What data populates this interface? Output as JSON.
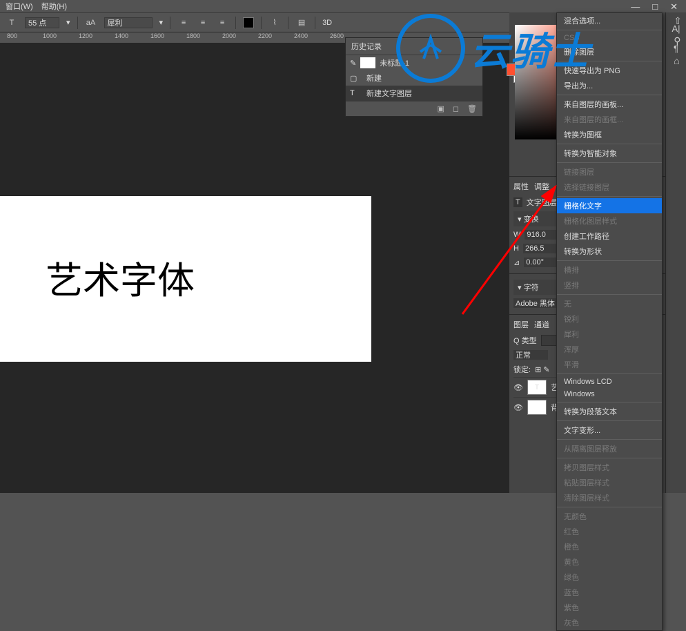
{
  "menubar": {
    "window": "窗口(W)",
    "help": "帮助(H)"
  },
  "options_bar": {
    "font_size_label": "T",
    "font_size": "55 点",
    "aa_label": "aA",
    "aa_mode": "犀利",
    "threeD": "3D"
  },
  "ruler": [
    "800",
    "1000",
    "1200",
    "1400",
    "1600",
    "1800",
    "2000",
    "2200",
    "2400",
    "2600"
  ],
  "canvas": {
    "text": "艺术字体"
  },
  "history": {
    "title": "历史记录",
    "doc_name": "未标题-1",
    "items": [
      {
        "icon": "new",
        "label": "新建"
      },
      {
        "icon": "T",
        "label": "新建文字图层"
      }
    ]
  },
  "properties": {
    "tab_props": "属性",
    "tab_adjust": "调整",
    "type_label": "文字图层",
    "transform_hdr": "变换",
    "w_label": "W",
    "w_val": "916.0",
    "h_label": "H",
    "h_val": "266.5",
    "angle_val": "0.00°"
  },
  "character": {
    "hdr": "字符",
    "font": "Adobe 黑体 Std"
  },
  "layers": {
    "tab_layers": "图层",
    "tab_channels": "通道",
    "filter_label": "Q 类型",
    "blend": "正常",
    "lock_label": "锁定:",
    "items": [
      {
        "type": "T",
        "name": "艺术"
      },
      {
        "type": "bg",
        "name": "背"
      }
    ]
  },
  "context_menu": [
    {
      "label": "混合选项...",
      "enabled": true
    },
    {
      "sep": true
    },
    {
      "label": "CSS",
      "enabled": false
    },
    {
      "label": "删除图层",
      "enabled": true
    },
    {
      "sep": true
    },
    {
      "label": "快速导出为 PNG",
      "enabled": true
    },
    {
      "label": "导出为...",
      "enabled": true
    },
    {
      "sep": true
    },
    {
      "label": "来自图层的画板...",
      "enabled": true
    },
    {
      "label": "来自图层的画框...",
      "enabled": false
    },
    {
      "label": "转换为图框",
      "enabled": true
    },
    {
      "sep": true
    },
    {
      "label": "转换为智能对象",
      "enabled": true
    },
    {
      "sep": true
    },
    {
      "label": "链接图层",
      "enabled": false
    },
    {
      "label": "选择链接图层",
      "enabled": false
    },
    {
      "sep": true
    },
    {
      "label": "栅格化文字",
      "enabled": true,
      "highlighted": true
    },
    {
      "label": "栅格化图层样式",
      "enabled": false
    },
    {
      "label": "创建工作路径",
      "enabled": true
    },
    {
      "label": "转换为形状",
      "enabled": true
    },
    {
      "sep": true
    },
    {
      "label": "横排",
      "enabled": false
    },
    {
      "label": "竖排",
      "enabled": false
    },
    {
      "sep": true
    },
    {
      "label": "无",
      "enabled": false
    },
    {
      "label": "锐利",
      "enabled": false
    },
    {
      "label": "犀利",
      "enabled": false
    },
    {
      "label": "浑厚",
      "enabled": false
    },
    {
      "label": "平滑",
      "enabled": false
    },
    {
      "sep": true
    },
    {
      "label": "Windows LCD",
      "enabled": true
    },
    {
      "label": "Windows",
      "enabled": true
    },
    {
      "sep": true
    },
    {
      "label": "转换为段落文本",
      "enabled": true
    },
    {
      "sep": true
    },
    {
      "label": "文字变形...",
      "enabled": true
    },
    {
      "sep": true
    },
    {
      "label": "从隔离图层释放",
      "enabled": false
    },
    {
      "sep": true
    },
    {
      "label": "拷贝图层样式",
      "enabled": false
    },
    {
      "label": "粘贴图层样式",
      "enabled": false
    },
    {
      "label": "清除图层样式",
      "enabled": false
    },
    {
      "sep": true
    },
    {
      "label": "无颜色",
      "enabled": false
    },
    {
      "label": "红色",
      "enabled": false
    },
    {
      "label": "橙色",
      "enabled": false
    },
    {
      "label": "黄色",
      "enabled": false
    },
    {
      "label": "绿色",
      "enabled": false
    },
    {
      "label": "蓝色",
      "enabled": false
    },
    {
      "label": "紫色",
      "enabled": false
    },
    {
      "label": "灰色",
      "enabled": false
    }
  ],
  "watermark": "云骑士"
}
